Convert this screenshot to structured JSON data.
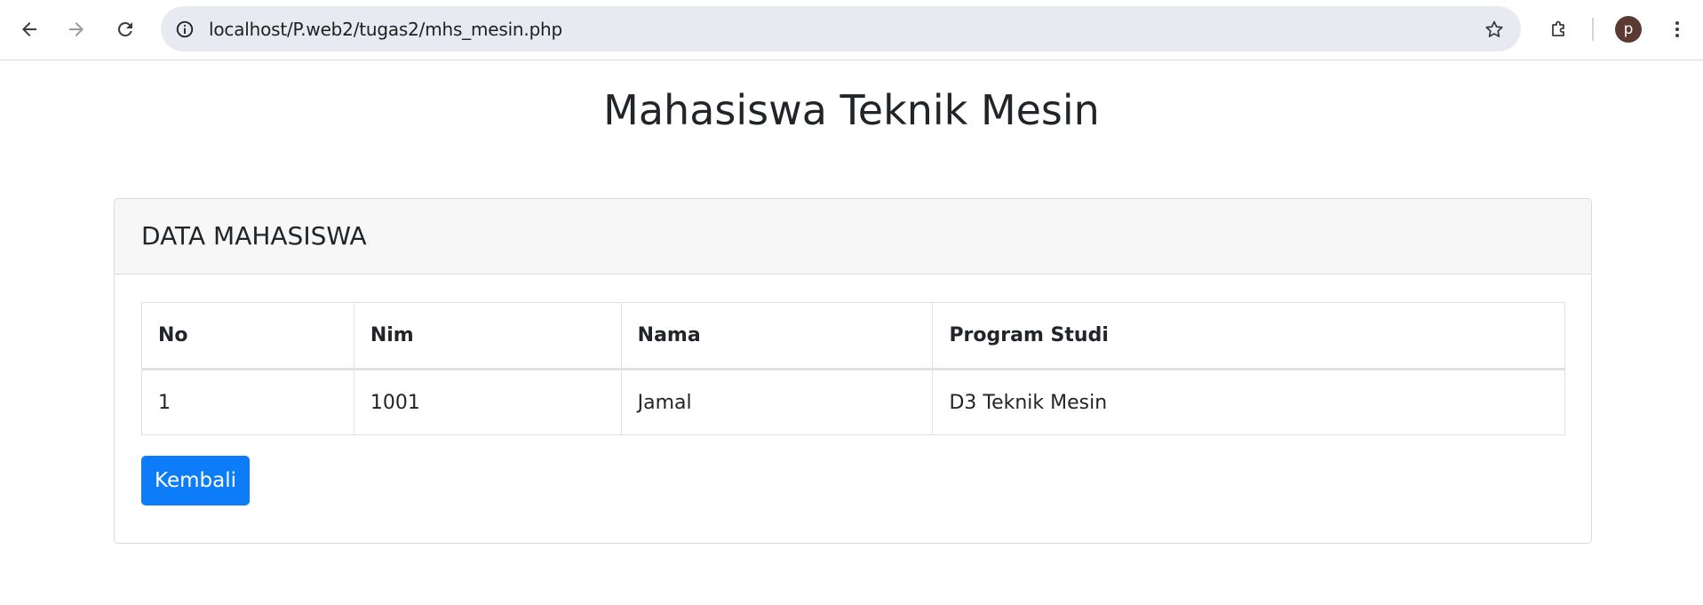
{
  "browser": {
    "url": "localhost/P.web2/tugas2/mhs_mesin.php",
    "profile_initial": "p",
    "icons": {
      "back": "arrow-left-icon",
      "forward": "arrow-right-icon",
      "reload": "reload-icon",
      "site_info": "info-circle-icon",
      "bookmark": "star-outline-icon",
      "extensions": "puzzle-icon",
      "menu": "kebab-menu-icon"
    }
  },
  "page": {
    "title": "Mahasiswa Teknik Mesin"
  },
  "card": {
    "header": "DATA MAHASISWA",
    "table": {
      "columns": [
        "No",
        "Nim",
        "Nama",
        "Program Studi"
      ],
      "rows": [
        [
          "1",
          "1001",
          "Jamal",
          "D3 Teknik Mesin"
        ]
      ]
    },
    "back_button": "Kembali"
  },
  "colors": {
    "primary_button": "#0d7cf8",
    "text": "#212529",
    "card_header_bg": "#f7f7f7",
    "omnibox_bg": "#e9e9f2",
    "avatar_bg": "#5a3a33"
  }
}
